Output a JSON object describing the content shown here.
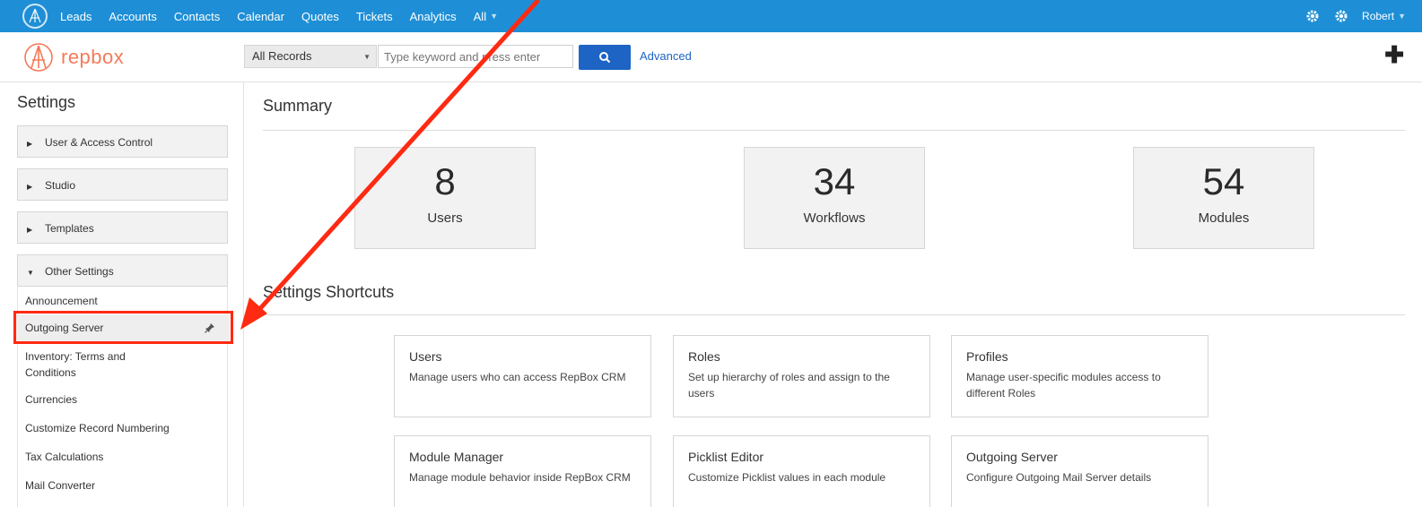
{
  "topnav": {
    "items": [
      "Leads",
      "Accounts",
      "Contacts",
      "Calendar",
      "Quotes",
      "Tickets",
      "Analytics"
    ],
    "all_label": "All",
    "user_name": "Robert"
  },
  "header": {
    "brand": "repbox",
    "search_select": "All Records",
    "search_placeholder": "Type keyword and press enter",
    "advanced_label": "Advanced"
  },
  "sidebar": {
    "title": "Settings",
    "sections": [
      "User & Access Control",
      "Studio",
      "Templates",
      "Other Settings"
    ],
    "items": [
      "Announcement",
      "Outgoing Server",
      "Inventory: Terms and Conditions",
      "Currencies",
      "Customize Record Numbering",
      "Tax Calculations",
      "Mail Converter"
    ]
  },
  "summary": {
    "title": "Summary",
    "stats": [
      {
        "value": "8",
        "label": "Users"
      },
      {
        "value": "34",
        "label": "Workflows"
      },
      {
        "value": "54",
        "label": "Modules"
      }
    ]
  },
  "shortcuts": {
    "title": "Settings Shortcuts",
    "cards": [
      {
        "title": "Users",
        "desc": "Manage users who can access RepBox CRM"
      },
      {
        "title": "Roles",
        "desc": "Set up hierarchy of roles and assign to the users"
      },
      {
        "title": "Profiles",
        "desc": "Manage user-specific modules access to different Roles"
      },
      {
        "title": "Module Manager",
        "desc": "Manage module behavior inside RepBox CRM"
      },
      {
        "title": "Picklist Editor",
        "desc": "Customize Picklist values in each module"
      },
      {
        "title": "Outgoing Server",
        "desc": "Configure Outgoing Mail Server details"
      }
    ]
  },
  "colors": {
    "nav_blue": "#1e8fd6",
    "brand_orange": "#f47b5a",
    "button_blue": "#1d64c4",
    "annotation_red": "#ff2a12"
  }
}
